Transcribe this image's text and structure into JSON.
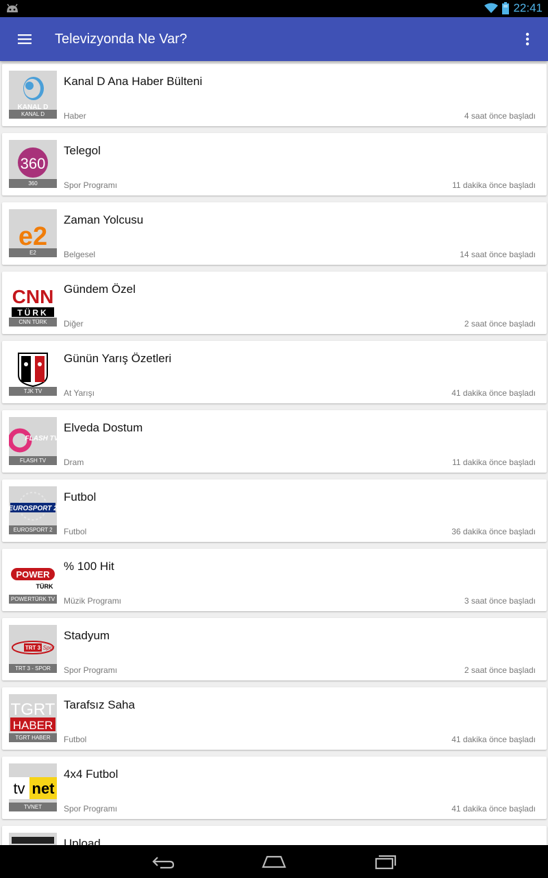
{
  "status_bar": {
    "time": "22:41"
  },
  "app_bar": {
    "title": "Televizyonda Ne Var?",
    "menu_icon": "menu-icon",
    "more_icon": "more-vert-icon"
  },
  "programs": [
    {
      "title": "Kanal D Ana Haber Bülteni",
      "genre": "Haber",
      "started": "4 saat önce başladı",
      "channel": "KANAL D",
      "logo_text": "KANAL D"
    },
    {
      "title": "Telegol",
      "genre": "Spor Programı",
      "started": "11 dakika önce başladı",
      "channel": "360",
      "logo_text": "360"
    },
    {
      "title": "Zaman Yolcusu",
      "genre": "Belgesel",
      "started": "14 saat önce başladı",
      "channel": "E2",
      "logo_text": "e2"
    },
    {
      "title": "Gündem Özel",
      "genre": "Diğer",
      "started": "2 saat önce başladı",
      "channel": "CNN TÜRK",
      "logo_text": "CNN",
      "logo_sub": "TÜRK"
    },
    {
      "title": "Günün Yarış Özetleri",
      "genre": "At Yarışı",
      "started": "41 dakika önce başladı",
      "channel": "TJK TV"
    },
    {
      "title": "Elveda Dostum",
      "genre": "Dram",
      "started": "11 dakika önce başladı",
      "channel": "FLASH TV",
      "logo_text": "FLASH TV"
    },
    {
      "title": "Futbol",
      "genre": "Futbol",
      "started": "36 dakika önce başladı",
      "channel": "EUROSPORT 2",
      "logo_text": "EUROSPORT 2"
    },
    {
      "title": "% 100 Hit",
      "genre": "Müzik Programı",
      "started": "3 saat önce başladı",
      "channel": "POWERTÜRK TV",
      "logo_text": "POWER",
      "logo_sub": "TÜRK"
    },
    {
      "title": "Stadyum",
      "genre": "Spor Programı",
      "started": "2 saat önce başladı",
      "channel": "TRT 3 - SPOR",
      "logo_text": "TRT 3",
      "logo_sub": "Spor"
    },
    {
      "title": "Tarafsız Saha",
      "genre": "Futbol",
      "started": "41 dakika önce başladı",
      "channel": "TGRT HABER",
      "logo_text": "TGRT",
      "logo_sub": "HABER"
    },
    {
      "title": "4x4 Futbol",
      "genre": "Spor Programı",
      "started": "41 dakika önce başladı",
      "channel": "TVNET",
      "logo_text": "tv",
      "logo_sub": "net"
    },
    {
      "title": "Upload",
      "genre": "",
      "started": "",
      "channel": ""
    }
  ],
  "nav_bar": {
    "back_icon": "back-icon",
    "home_icon": "home-icon",
    "recents_icon": "recents-icon"
  }
}
